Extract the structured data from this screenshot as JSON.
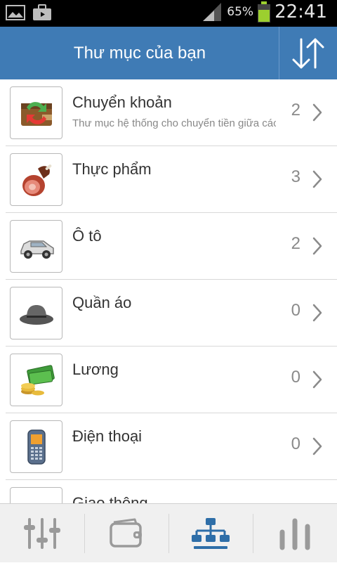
{
  "status_bar": {
    "battery_pct": "65%",
    "time": "22:41"
  },
  "header": {
    "title": "Thư mục của bạn"
  },
  "colors": {
    "header_bg": "#3f7bb5",
    "accent_active": "#2e6ea8"
  },
  "folders": [
    {
      "name": "Chuyển khoản",
      "subtitle": "Thư mục hệ thống cho chuyển tiền giữa các tài khoản",
      "count": "2",
      "icon": "transfer-icon"
    },
    {
      "name": "Thực phẩm",
      "subtitle": "",
      "count": "3",
      "icon": "ham-icon"
    },
    {
      "name": "Ô tô",
      "subtitle": "",
      "count": "2",
      "icon": "car-icon"
    },
    {
      "name": "Quần áo",
      "subtitle": "",
      "count": "0",
      "icon": "hat-icon"
    },
    {
      "name": "Lương",
      "subtitle": "",
      "count": "0",
      "icon": "money-icon"
    },
    {
      "name": "Điện thoại",
      "subtitle": "",
      "count": "0",
      "icon": "phone-icon"
    },
    {
      "name": "Giao thông",
      "subtitle": "",
      "count": "",
      "icon": "coins-icon"
    }
  ],
  "bottom_nav": [
    {
      "icon": "sliders-icon",
      "active": false
    },
    {
      "icon": "wallet-icon",
      "active": false
    },
    {
      "icon": "hierarchy-icon",
      "active": true
    },
    {
      "icon": "bar-chart-icon",
      "active": false
    }
  ]
}
